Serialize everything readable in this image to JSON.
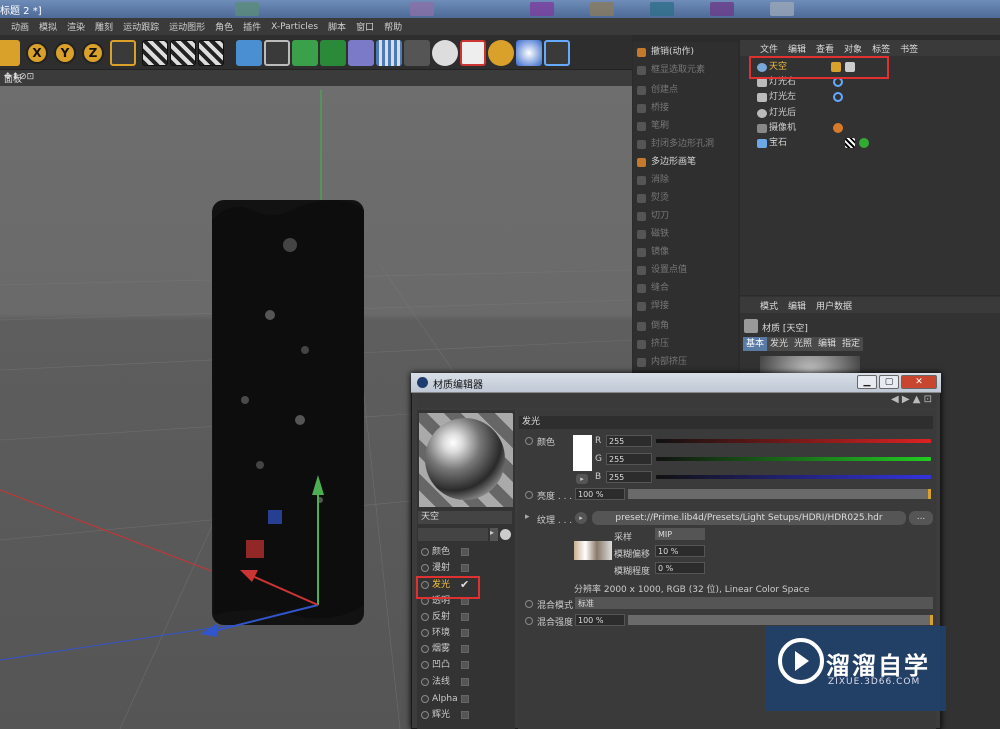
{
  "titlebar": {
    "text": "标题 2 *]"
  },
  "menubar": [
    "动画",
    "模拟",
    "渲染",
    "雕刻",
    "运动跟踪",
    "运动图形",
    "角色",
    "插件",
    "X-Particles",
    "脚本",
    "窗口",
    "帮助"
  ],
  "toolbar": {
    "xyz": [
      "X",
      "Y",
      "Z"
    ]
  },
  "viewport": {
    "label": "面板",
    "icons": "✥⬍⊘⊡"
  },
  "commands": {
    "items": [
      {
        "label": "撤销(动作)",
        "enabled": true
      },
      {
        "label": "框显选取元素",
        "enabled": false
      },
      {
        "label": "创建点",
        "enabled": false
      },
      {
        "label": "桥接",
        "enabled": false
      },
      {
        "label": "笔刷",
        "enabled": false
      },
      {
        "label": "封闭多边形孔洞",
        "enabled": false
      },
      {
        "label": "多边形画笔",
        "enabled": true
      },
      {
        "label": "消除",
        "enabled": false
      },
      {
        "label": "熨烫",
        "enabled": false
      },
      {
        "label": "切刀",
        "enabled": false
      },
      {
        "label": "磁铁",
        "enabled": false
      },
      {
        "label": "镜像",
        "enabled": false
      },
      {
        "label": "设置点值",
        "enabled": false
      },
      {
        "label": "缝合",
        "enabled": false
      },
      {
        "label": "焊接",
        "enabled": false
      },
      {
        "label": "倒角",
        "enabled": false
      },
      {
        "label": "挤压",
        "enabled": false
      },
      {
        "label": "内部挤压",
        "enabled": false
      }
    ]
  },
  "object_manager": {
    "menu": [
      "文件",
      "编辑",
      "查看",
      "对象",
      "标签",
      "书签"
    ],
    "objects": [
      "天空",
      "灯光右",
      "灯光左",
      "灯光后",
      "摄像机",
      "宝石"
    ]
  },
  "attribute_manager": {
    "menu": [
      "模式",
      "编辑",
      "用户数据"
    ],
    "title": "材质 [天空]",
    "tabs": [
      "基本",
      "发光",
      "光照",
      "编辑",
      "指定"
    ]
  },
  "material_editor": {
    "title": "材质编辑器",
    "buttons": {
      "min": "▁",
      "max": "▢",
      "close": "✕"
    },
    "material_name": "天空",
    "channels": [
      "颜色",
      "漫射",
      "发光",
      "透明",
      "反射",
      "环境",
      "烟雾",
      "凹凸",
      "法线",
      "Alpha",
      "辉光"
    ],
    "checkmark": "✔",
    "section": "发光",
    "color_label": "颜色",
    "r": {
      "label": "R",
      "value": "255"
    },
    "g": {
      "label": "G",
      "value": "255"
    },
    "b": {
      "label": "B",
      "value": "255"
    },
    "brightness": {
      "label": "亮度 . . . .",
      "value": "100 %"
    },
    "texture": {
      "label": "纹理 . . .",
      "path": "preset://Prime.lib4d/Presets/Light Setups/HDRI/HDR025.hdr",
      "more": "..."
    },
    "sampling": {
      "label": "采样",
      "value": "MIP"
    },
    "blur_offset": {
      "label": "模糊偏移",
      "value": "10 %"
    },
    "blur_scale": {
      "label": "模糊程度",
      "value": "0 %"
    },
    "resolution": "分辨率 2000 x 1000, RGB (32 位), Linear Color Space",
    "mix_mode": {
      "label": "混合模式",
      "value": "标准"
    },
    "mix_strength": {
      "label": "混合强度",
      "value": "100 %"
    }
  },
  "watermark": {
    "title": "溜溜自学",
    "url": "ZIXUE.3D66.COM"
  },
  "colors": {
    "accent_red": "#e03030",
    "selection_yellow": "#f0c040",
    "watermark_bg": "#214069"
  }
}
